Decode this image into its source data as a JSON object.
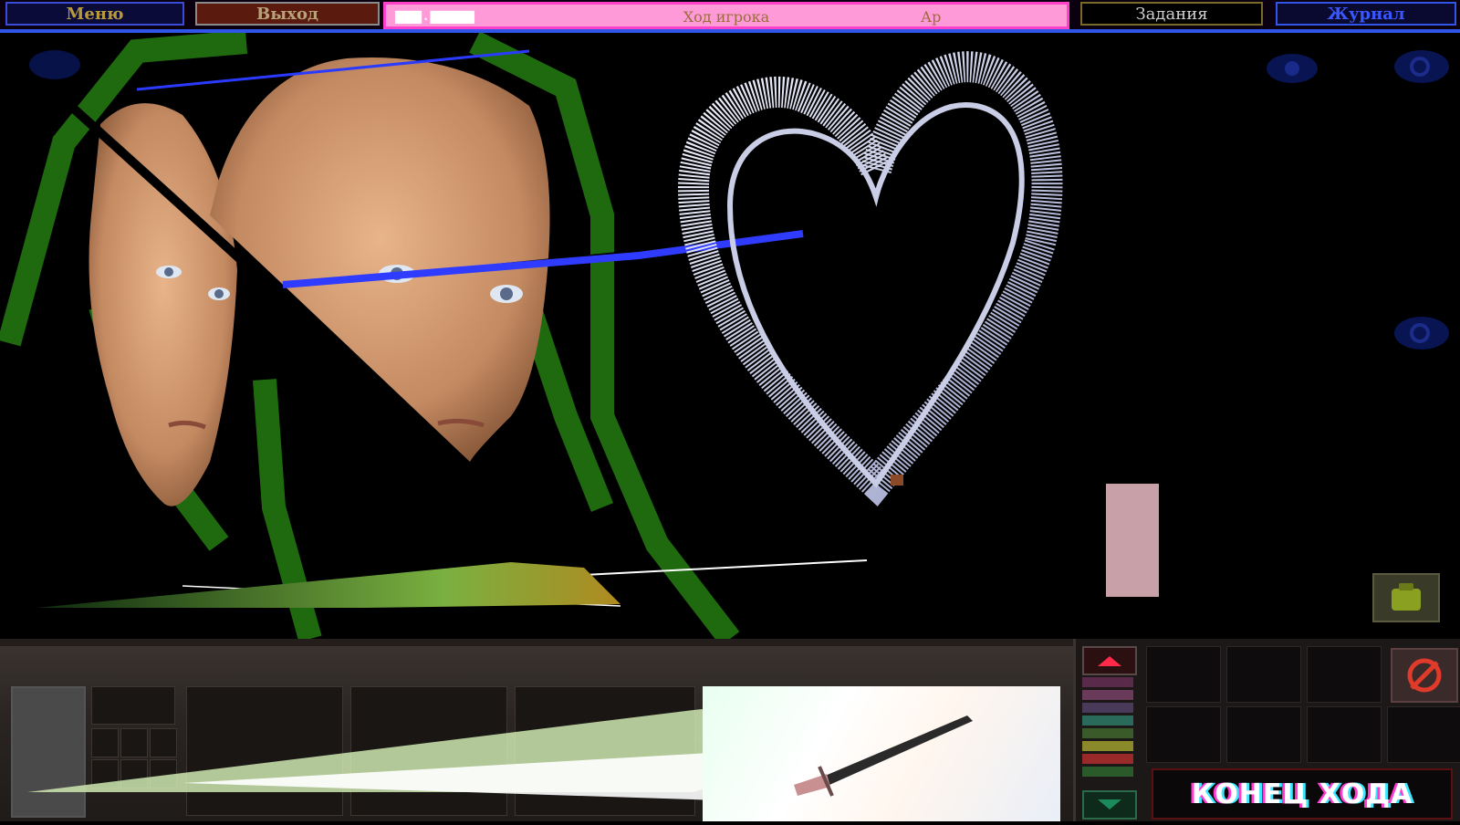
{
  "top_bar": {
    "menu_label": "Меню",
    "exit_label": "Выход",
    "banner": {
      "left_text": "▆▆▆.▆▆▆▆▆",
      "center_text": "Ход игрока",
      "right_text": "Ар"
    },
    "tasks_label": "Задания",
    "journal_label": "Журнал"
  },
  "scene": {
    "icons": [
      "eye-icon",
      "eye-icon",
      "eye-icon",
      "eye-icon"
    ],
    "backpack_icon": "backpack-icon"
  },
  "bottom_bar": {
    "end_turn_label": "КОНЕЦ ХОДА",
    "item_view_label": "dagger-icon",
    "scroll_up": "arrow-up-icon",
    "scroll_down": "arrow-down-icon",
    "cancel": "cancel-icon"
  },
  "colors": {
    "banner_bg": "#ff9ad8",
    "banner_border": "#ff40c8",
    "journal_blue": "#3a57ff",
    "menu_border": "#3a4bd6",
    "green_outline": "#1f6a0e"
  }
}
